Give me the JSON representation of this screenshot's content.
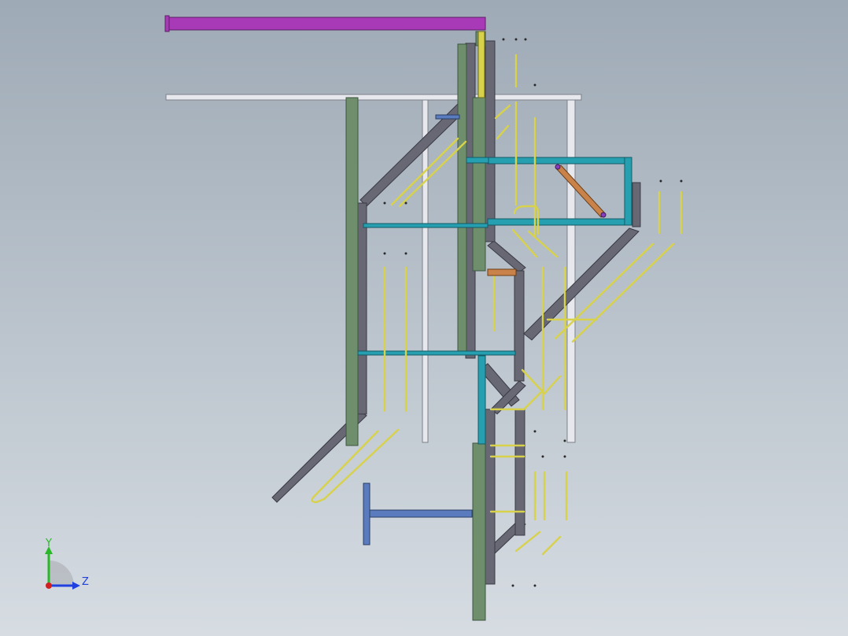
{
  "viewport": {
    "background_top": "#9eaab6",
    "background_bottom": "#d6dce2"
  },
  "colors": {
    "purple_beam": "#a83ab8",
    "white_beam": "#e6e8ee",
    "green_column": "#6f8e6c",
    "green_column_edge": "#3e5640",
    "gray_stringer": "#686874",
    "gray_stringer_edge": "#3a3a44",
    "cyan_beam": "#26a0b0",
    "cyan_edge": "#145a66",
    "yellow_rail": "#d8d24a",
    "yellow_rail_edge": "#6e6a1e",
    "blue_pedestal": "#5a7cbf",
    "orange_brace": "#c9834a",
    "axis_x": "#d02020",
    "axis_y": "#2ab82a",
    "axis_z": "#2040e0"
  },
  "triad": {
    "y_label": "Y",
    "z_label": "Z",
    "icon": "coordinate-triad-icon"
  }
}
